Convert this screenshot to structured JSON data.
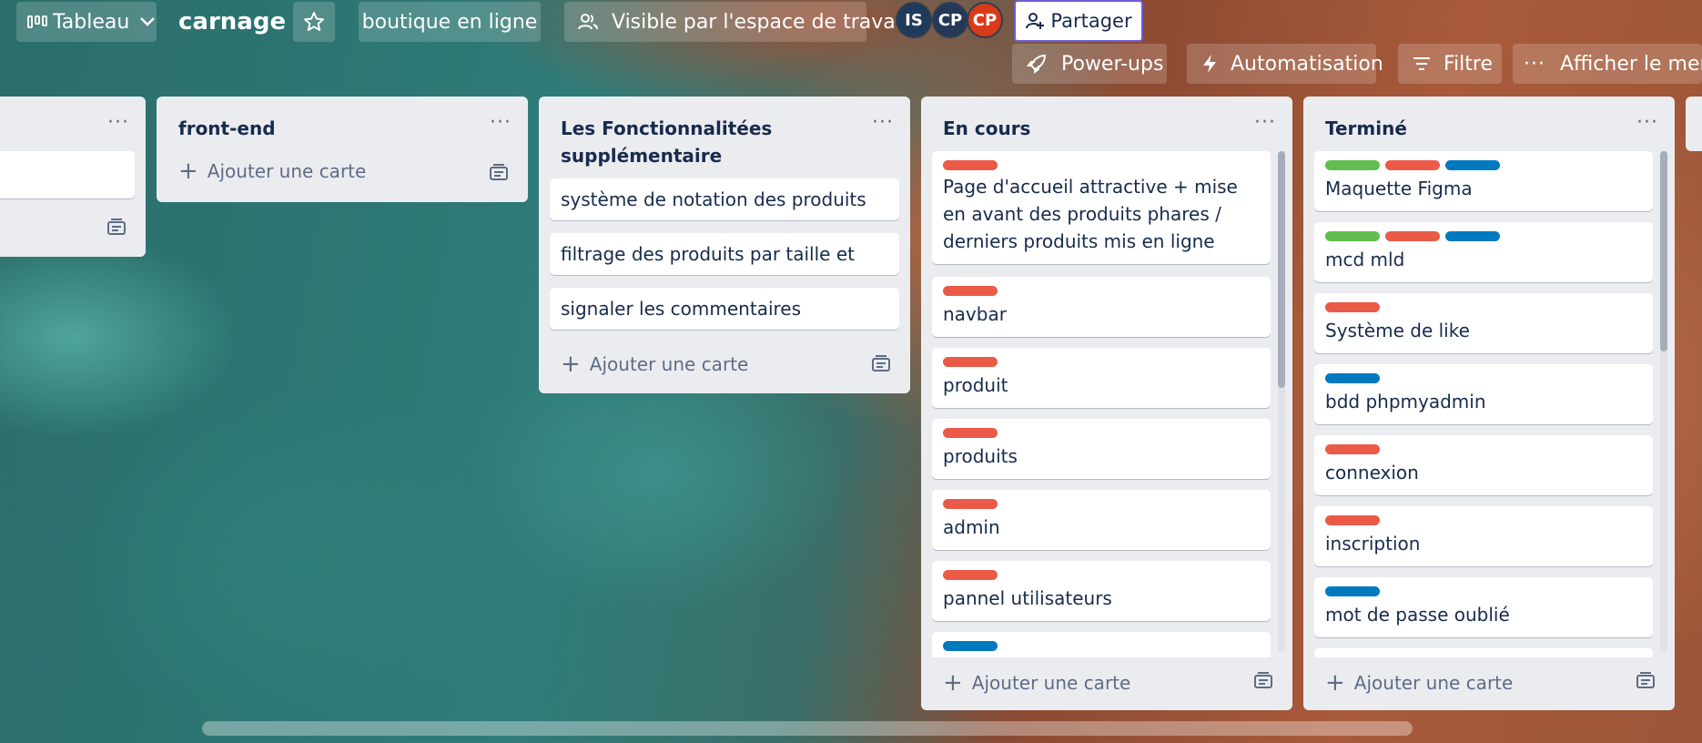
{
  "header": {
    "view_label": "Tableau",
    "board_name": "carnage",
    "workspace_label": "boutique en ligne",
    "visibility_label": "Visible par l'espace de travail",
    "members": [
      {
        "initials": "IS",
        "color": "#1f3a5a"
      },
      {
        "initials": "CP",
        "color": "#253858"
      },
      {
        "initials": "CP",
        "color": "#d93a1a"
      }
    ],
    "share_label": "Partager"
  },
  "subheader": {
    "powerups_label": "Power-ups",
    "automation_label": "Automatisation",
    "filter_label": "Filtre",
    "menu_label": "Afficher le menu"
  },
  "lists": [
    {
      "title": "",
      "add_label": ""
    },
    {
      "title": "front-end",
      "add_label": "Ajouter une carte"
    },
    {
      "title": "Les Fonctionnalitées supplémentaire",
      "add_label": "Ajouter une carte",
      "cards": [
        "système de notation des produits",
        "filtrage des produits par taille et prix",
        "signaler les commentaires"
      ]
    },
    {
      "title": "En cours",
      "add_label": "Ajouter une carte",
      "cards": [
        {
          "text": "Page d'accueil attractive + mise en avant des produits phares / derniers produits mis en ligne",
          "labels": [
            "#eb5a46"
          ]
        },
        {
          "text": "navbar",
          "labels": [
            "#eb5a46"
          ]
        },
        {
          "text": "produit",
          "labels": [
            "#eb5a46"
          ]
        },
        {
          "text": "produits",
          "labels": [
            "#eb5a46"
          ]
        },
        {
          "text": "admin",
          "labels": [
            "#eb5a46"
          ]
        },
        {
          "text": "pannel utilisateurs",
          "labels": [
            "#eb5a46"
          ]
        },
        {
          "text": "",
          "labels": [
            "#0079bf"
          ]
        }
      ]
    },
    {
      "title": "Terminé",
      "add_label": "Ajouter une carte",
      "cards": [
        {
          "text": "Maquette Figma",
          "labels": [
            "#61bd4f",
            "#eb5a46",
            "#0079bf"
          ]
        },
        {
          "text": "mcd mld",
          "labels": [
            "#61bd4f",
            "#eb5a46",
            "#0079bf"
          ]
        },
        {
          "text": "Système de like",
          "labels": [
            "#eb5a46"
          ]
        },
        {
          "text": "bdd phpmyadmin",
          "labels": [
            "#0079bf"
          ]
        },
        {
          "text": "connexion",
          "labels": [
            "#eb5a46"
          ]
        },
        {
          "text": "inscription",
          "labels": [
            "#eb5a46"
          ]
        },
        {
          "text": "mot de passe oublié",
          "labels": [
            "#0079bf"
          ]
        },
        {
          "text": "",
          "labels": [
            "#0079bf"
          ]
        }
      ]
    }
  ]
}
